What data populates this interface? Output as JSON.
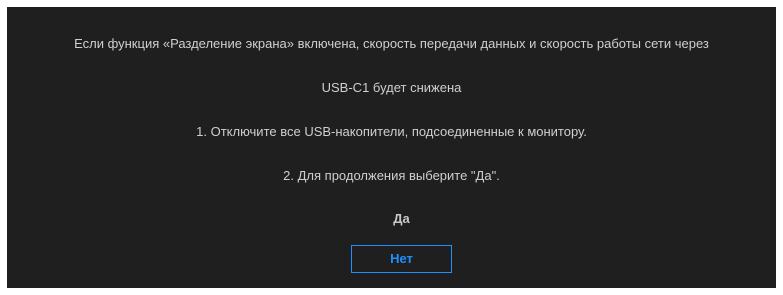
{
  "message": {
    "line1": "Если функция «Разделение экрана» включена, скорость передачи данных и скорость работы сети через",
    "line2": "USB-C1 будет снижена",
    "step1": "1. Отключите все USB-накопители, подсоединенные к монитору.",
    "step2": "2. Для продолжения выберите \"Да\"."
  },
  "buttons": {
    "yes_label": "Да",
    "no_label": "Нет",
    "focused": "no"
  },
  "colors": {
    "background": "#1f1f1f",
    "text": "#cfcfcf",
    "accent": "#1e90ff"
  }
}
